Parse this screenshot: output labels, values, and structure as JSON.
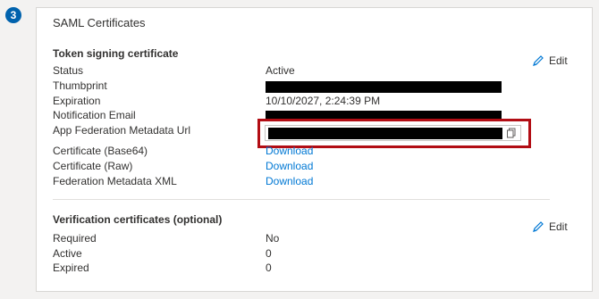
{
  "step": {
    "number": "3"
  },
  "card": {
    "title": "SAML Certificates"
  },
  "token_signing": {
    "title": "Token signing certificate",
    "edit_label": "Edit",
    "rows": {
      "status": {
        "label": "Status",
        "value": "Active"
      },
      "thumbprint": {
        "label": "Thumbprint"
      },
      "expiration": {
        "label": "Expiration",
        "value": "10/10/2027, 2:24:39 PM"
      },
      "notification_email": {
        "label": "Notification Email"
      },
      "metadata_url": {
        "label": "App Federation Metadata Url"
      },
      "cert_base64": {
        "label": "Certificate (Base64)",
        "value": "Download"
      },
      "cert_raw": {
        "label": "Certificate (Raw)",
        "value": "Download"
      },
      "federation_xml": {
        "label": "Federation Metadata XML",
        "value": "Download"
      }
    }
  },
  "verification": {
    "title": "Verification certificates (optional)",
    "edit_label": "Edit",
    "rows": {
      "required": {
        "label": "Required",
        "value": "No"
      },
      "active": {
        "label": "Active",
        "value": "0"
      },
      "expired": {
        "label": "Expired",
        "value": "0"
      }
    }
  },
  "colors": {
    "accent": "#0078d4",
    "badge": "#0062ad",
    "highlight": "#b20d14"
  },
  "icons": {
    "edit": "pencil-icon",
    "copy": "copy-icon"
  }
}
